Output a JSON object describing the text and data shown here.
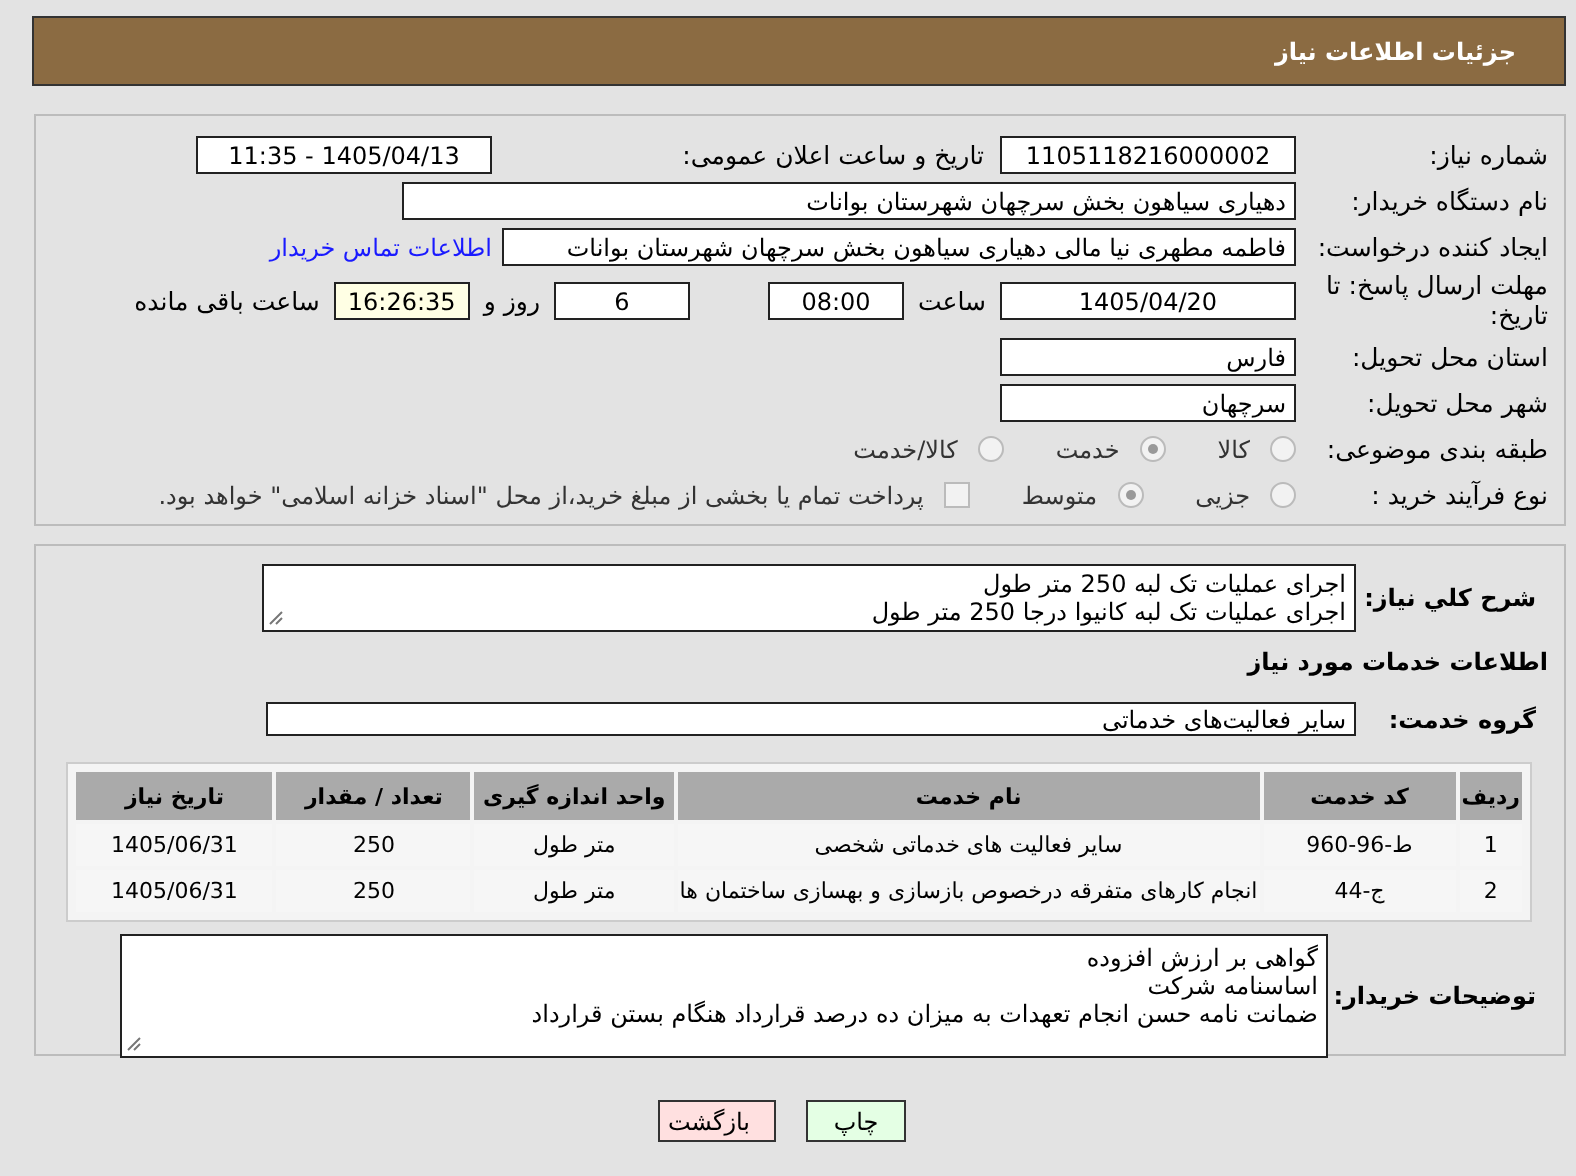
{
  "title": "جزئیات اطلاعات نیاز",
  "need_number": {
    "label": "شماره نیاز:",
    "value": "1105118216000002"
  },
  "announce": {
    "label": "تاریخ و ساعت اعلان عمومی:",
    "value": "1405/04/13 - 11:35"
  },
  "buyer_org": {
    "label": "نام دستگاه خریدار:",
    "value": "دهیاری سیاهون بخش سرچهان شهرستان بوانات"
  },
  "requester": {
    "label": "ایجاد کننده درخواست:",
    "value": "فاطمه مطهری نیا مالی دهیاری سیاهون بخش سرچهان شهرستان بوانات",
    "link": "اطلاعات تماس خریدار"
  },
  "deadline": {
    "label": "مهلت ارسال پاسخ: تا تاریخ:",
    "date": "1405/04/20",
    "time_label": "ساعت",
    "time": "08:00",
    "days": "6",
    "days_label": "روز و",
    "remaining": "16:26:35",
    "remaining_label": "ساعت باقی مانده"
  },
  "province": {
    "label": "استان محل تحویل:",
    "value": "فارس"
  },
  "city": {
    "label": "شهر محل تحویل:",
    "value": "سرچهان"
  },
  "category": {
    "label": "طبقه بندی موضوعی:",
    "options": [
      {
        "label": "کالا",
        "selected": false
      },
      {
        "label": "خدمت",
        "selected": true
      },
      {
        "label": "کالا/خدمت",
        "selected": false
      }
    ]
  },
  "process": {
    "label": "نوع فرآیند خرید :",
    "options": [
      {
        "label": "جزیی",
        "selected": false
      },
      {
        "label": "متوسط",
        "selected": true
      }
    ],
    "payment": {
      "label": "پرداخت تمام یا بخشی از مبلغ خرید،از محل \"اسناد خزانه اسلامی\" خواهد بود.",
      "checked": false
    }
  },
  "description": {
    "label": "شرح كلي نياز:",
    "lines": [
      "اجرای عملیات تک لبه 250 متر طول",
      "اجرای عملیات تک لبه کانیوا درجا 250 متر طول"
    ]
  },
  "services_title": "اطلاعات خدمات مورد نیاز",
  "service_group": {
    "label": "گروه خدمت:",
    "value": "سایر فعالیت‌های خدماتی"
  },
  "table": {
    "columns": [
      "ردیف",
      "کد خدمت",
      "نام خدمت",
      "واحد اندازه گیری",
      "تعداد / مقدار",
      "تاریخ نیاز"
    ],
    "rows": [
      [
        "1",
        "ط-96-960",
        "سایر فعالیت های خدماتی شخصی",
        "متر طول",
        "250",
        "1405/06/31"
      ],
      [
        "2",
        "ج-44",
        "انجام کارهای متفرقه درخصوص بازسازی و بهسازی ساختمان ها",
        "متر طول",
        "250",
        "1405/06/31"
      ]
    ]
  },
  "buyer_notes": {
    "label": "توضیحات خریدار:",
    "lines": [
      "گواهی بر ارزش افزوده",
      "اساسنامه شرکت",
      "ضمانت نامه حسن انجام تعهدات به میزان ده درصد قرارداد هنگام بستن قرارداد"
    ]
  },
  "buttons": [
    {
      "label": "چاپ",
      "kind": "print"
    },
    {
      "label": "بازگشت",
      "kind": "back"
    }
  ]
}
